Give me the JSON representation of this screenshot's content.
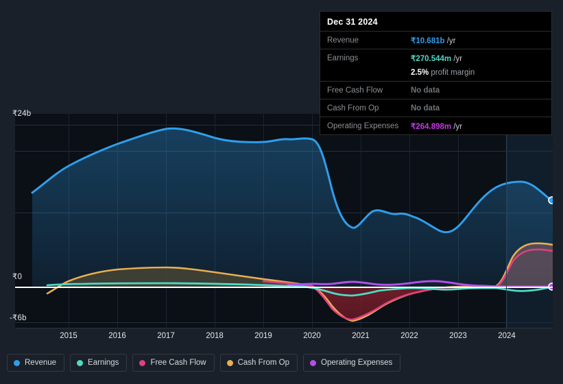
{
  "tooltip": {
    "title": "Dec 31 2024",
    "rows": [
      {
        "label": "Revenue",
        "value": "₹10.681b",
        "unit": "/yr",
        "color": "#2f9eeb",
        "nodata": false
      },
      {
        "label": "Earnings",
        "value": "₹270.544m",
        "unit": "/yr",
        "color": "#4fd9c4",
        "nodata": false
      },
      {
        "label": "",
        "value": "2.5%",
        "unit": "profit margin",
        "color": "#ffffff",
        "nodata": false
      },
      {
        "label": "Free Cash Flow",
        "value": "No data",
        "unit": "",
        "color": "#6e7479",
        "nodata": true
      },
      {
        "label": "Cash From Op",
        "value": "No data",
        "unit": "",
        "color": "#6e7479",
        "nodata": true
      },
      {
        "label": "Operating Expenses",
        "value": "₹264.898m",
        "unit": "/yr",
        "color": "#c13ae0",
        "nodata": false
      }
    ]
  },
  "axes": {
    "y_top_label": "₹24b",
    "y_zero_label": "₹0",
    "y_bottom_label": "-₹6b",
    "x_labels": [
      "2015",
      "2016",
      "2017",
      "2018",
      "2019",
      "2020",
      "2021",
      "2022",
      "2023",
      "2024"
    ]
  },
  "legend": [
    {
      "label": "Revenue",
      "color": "#2f9eeb"
    },
    {
      "label": "Earnings",
      "color": "#4fd9c4"
    },
    {
      "label": "Free Cash Flow",
      "color": "#e0407f"
    },
    {
      "label": "Cash From Op",
      "color": "#e8ae52"
    },
    {
      "label": "Operating Expenses",
      "color": "#b44fe8"
    }
  ],
  "chart_data": {
    "type": "area",
    "title": "",
    "xlabel": "",
    "ylabel": "",
    "ylim": [
      -6,
      24
    ],
    "y_ticks": [
      24,
      0,
      -6
    ],
    "y_unit": "₹ billions",
    "grid": true,
    "legend_position": "bottom",
    "currency": "INR",
    "forecast_start_x": "2023.9",
    "x": [
      2014.4,
      2015.0,
      2015.5,
      2016.0,
      2016.5,
      2017.0,
      2017.5,
      2018.0,
      2018.5,
      2019.0,
      2019.5,
      2020.0,
      2020.3,
      2020.6,
      2021.0,
      2021.4,
      2021.8,
      2022.0,
      2022.4,
      2022.8,
      2023.0,
      2023.4,
      2023.9,
      2024.2,
      2024.6,
      2025.0
    ],
    "series": [
      {
        "name": "Revenue",
        "color": "#2f9eeb",
        "values": [
          14.0,
          16.0,
          17.6,
          19.0,
          20.6,
          21.8,
          21.3,
          20.1,
          19.8,
          19.7,
          20.2,
          19.8,
          14.0,
          11.2,
          10.4,
          12.0,
          11.7,
          11.9,
          11.2,
          10.2,
          10.6,
          13.5,
          14.6,
          14.6,
          13.1,
          12.3
        ]
      },
      {
        "name": "Earnings",
        "color": "#4fd9c4",
        "values": [
          0.25,
          0.3,
          0.35,
          0.4,
          0.42,
          0.45,
          0.44,
          0.4,
          0.38,
          0.35,
          0.3,
          0.2,
          -0.4,
          -0.7,
          -0.75,
          -0.5,
          -0.2,
          -0.05,
          0.05,
          0.1,
          0.1,
          0.15,
          0.2,
          0.25,
          0.27,
          0.27
        ]
      },
      {
        "name": "Free Cash Flow",
        "color": "#e0407f",
        "values": [
          null,
          null,
          null,
          null,
          null,
          null,
          null,
          null,
          null,
          0.85,
          0.8,
          0.4,
          -1.0,
          -2.4,
          -3.3,
          -2.6,
          -1.6,
          -0.9,
          -0.3,
          -0.1,
          0.0,
          0.1,
          2.9,
          3.4,
          3.4,
          null
        ]
      },
      {
        "name": "Cash From Op",
        "color": "#e8ae52",
        "values": [
          -0.9,
          0.1,
          1.0,
          1.6,
          1.85,
          1.95,
          1.9,
          1.6,
          1.2,
          1.0,
          0.9,
          0.5,
          -0.9,
          -2.6,
          -3.6,
          -2.9,
          -1.8,
          -1.0,
          -0.35,
          -0.12,
          0.0,
          0.15,
          3.5,
          3.9,
          3.85,
          null
        ]
      },
      {
        "name": "Operating Expenses",
        "color": "#b44fe8",
        "values": [
          null,
          null,
          null,
          null,
          null,
          null,
          null,
          null,
          null,
          null,
          0.35,
          0.42,
          0.4,
          0.45,
          0.5,
          0.35,
          0.3,
          0.35,
          0.5,
          0.4,
          0.3,
          0.28,
          0.27,
          0.26,
          0.26,
          0.265
        ]
      }
    ]
  }
}
